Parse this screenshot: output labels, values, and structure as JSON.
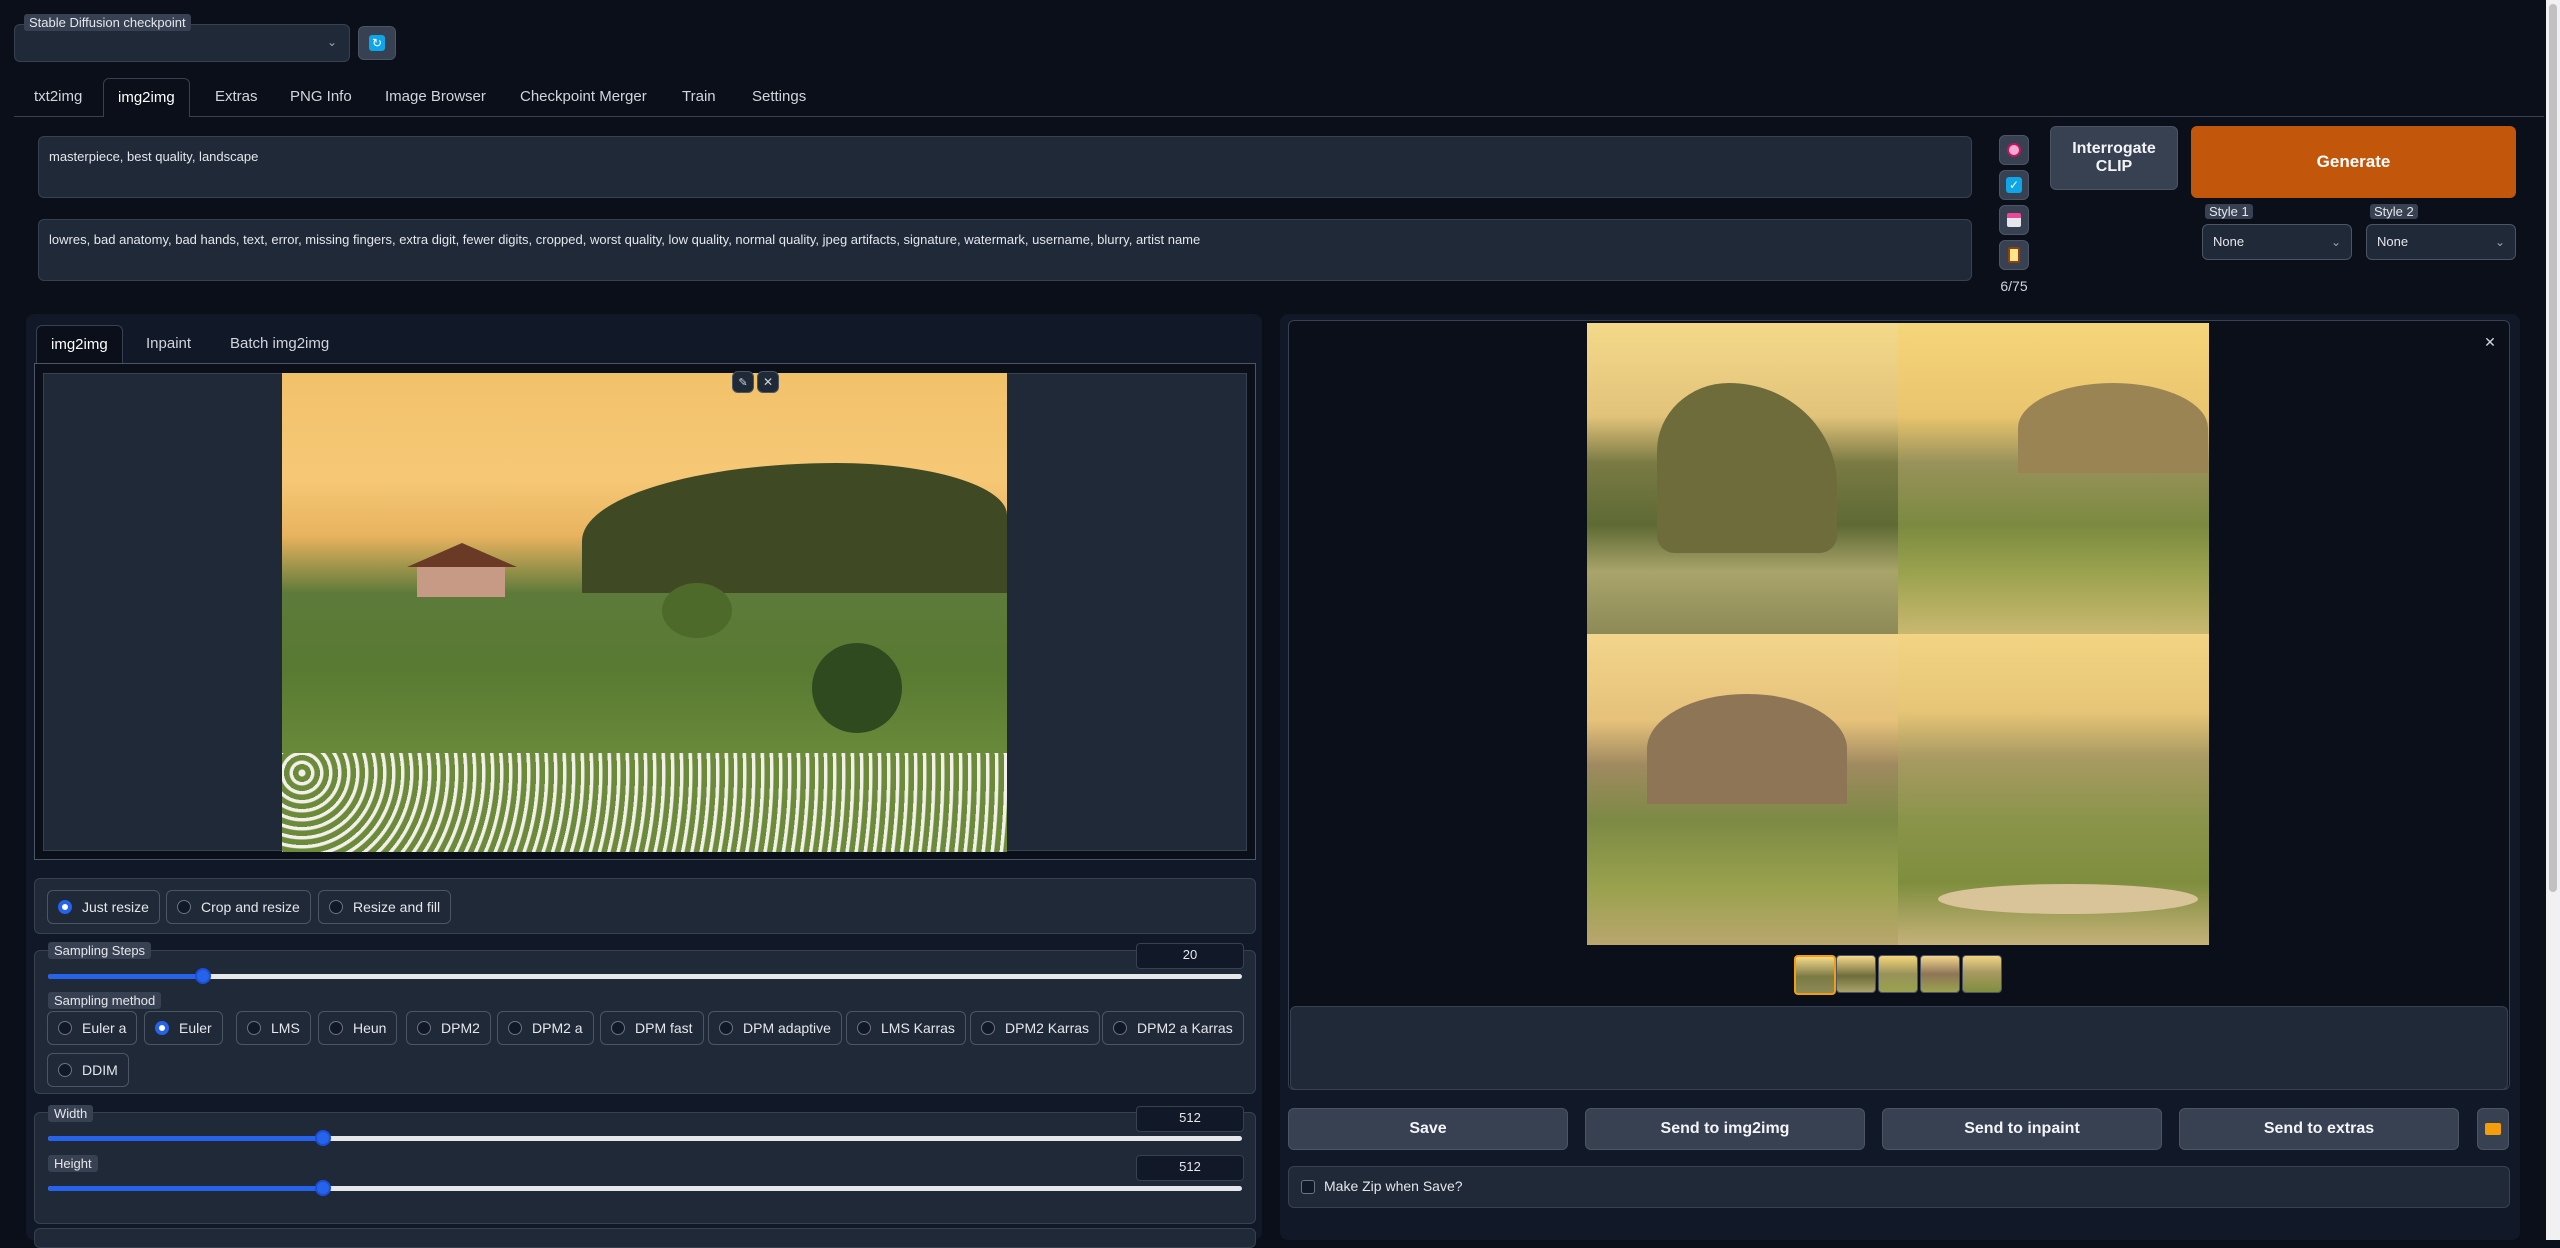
{
  "checkpoint": {
    "label": "Stable Diffusion checkpoint",
    "value": ""
  },
  "tabs": [
    {
      "label": "txt2img"
    },
    {
      "label": "img2img"
    },
    {
      "label": "Extras"
    },
    {
      "label": "PNG Info"
    },
    {
      "label": "Image Browser"
    },
    {
      "label": "Checkpoint Merger"
    },
    {
      "label": "Train"
    },
    {
      "label": "Settings"
    }
  ],
  "prompt": {
    "positive": "masterpiece, best quality, landscape",
    "negative": "lowres, bad anatomy, bad hands, text, error, missing fingers, extra digit, fewer digits, cropped, worst quality, low quality, normal quality, jpeg artifacts, signature, watermark, username, blurry, artist name"
  },
  "token_count": "6/75",
  "buttons": {
    "interrogate": "Interrogate CLIP",
    "generate": "Generate",
    "save": "Save",
    "send_img2img": "Send to img2img",
    "send_inpaint": "Send to inpaint",
    "send_extras": "Send to extras"
  },
  "styles": {
    "style1_label": "Style 1",
    "style1_value": "None",
    "style2_label": "Style 2",
    "style2_value": "None"
  },
  "subtabs": [
    {
      "label": "img2img"
    },
    {
      "label": "Inpaint"
    },
    {
      "label": "Batch img2img"
    }
  ],
  "resize_modes": [
    {
      "label": "Just resize",
      "selected": true
    },
    {
      "label": "Crop and resize",
      "selected": false
    },
    {
      "label": "Resize and fill",
      "selected": false
    }
  ],
  "sampling_steps": {
    "label": "Sampling Steps",
    "value": "20",
    "fraction": 0.13
  },
  "sampling_method": {
    "label": "Sampling method",
    "options": [
      {
        "label": "Euler a",
        "selected": false
      },
      {
        "label": "Euler",
        "selected": true
      },
      {
        "label": "LMS",
        "selected": false
      },
      {
        "label": "Heun",
        "selected": false
      },
      {
        "label": "DPM2",
        "selected": false
      },
      {
        "label": "DPM2 a",
        "selected": false
      },
      {
        "label": "DPM fast",
        "selected": false
      },
      {
        "label": "DPM adaptive",
        "selected": false
      },
      {
        "label": "LMS Karras",
        "selected": false
      },
      {
        "label": "DPM2 Karras",
        "selected": false
      },
      {
        "label": "DPM2 a Karras",
        "selected": false
      },
      {
        "label": "DDIM",
        "selected": false
      }
    ]
  },
  "width": {
    "label": "Width",
    "value": "512",
    "fraction": 0.23
  },
  "height": {
    "label": "Height",
    "value": "512",
    "fraction": 0.23
  },
  "make_zip": "Make Zip when Save?",
  "colors": {
    "accent": "#2563eb",
    "generate": "#c2570c",
    "bg": "#0b0f19",
    "panel": "#1f2937"
  }
}
